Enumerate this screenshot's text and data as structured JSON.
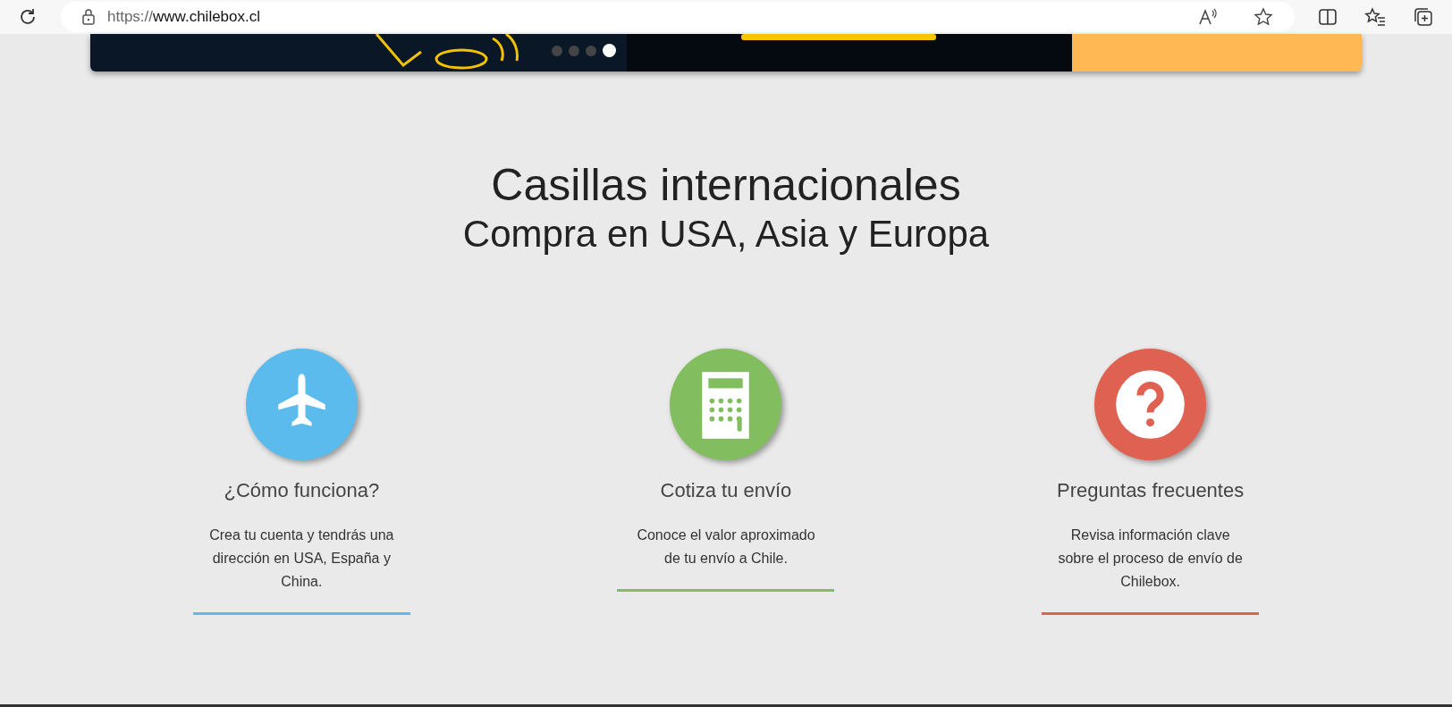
{
  "browser": {
    "url_scheme": "https://",
    "url_host": "www.chilebox.cl"
  },
  "carousel": {
    "dots": [
      {
        "selected": false
      },
      {
        "selected": false
      },
      {
        "selected": false
      },
      {
        "selected": true
      }
    ]
  },
  "heading": {
    "title": "Casillas internacionales",
    "subtitle": "Compra en USA, Asia y Europa"
  },
  "features": [
    {
      "kind": "plane",
      "color": "#5bbbec",
      "title": "¿Cómo funciona?",
      "text": "Crea tu cuenta y tendrás una dirección en USA, España y China."
    },
    {
      "kind": "calculator",
      "color": "#82bd60",
      "title": "Cotiza tu envío",
      "text": "Conoce el valor aproximado de tu envío a Chile."
    },
    {
      "kind": "question",
      "color": "#df6152",
      "title": "Preguntas frecuentes",
      "text": "Revisa información clave sobre el proceso de envío de Chilebox."
    }
  ]
}
